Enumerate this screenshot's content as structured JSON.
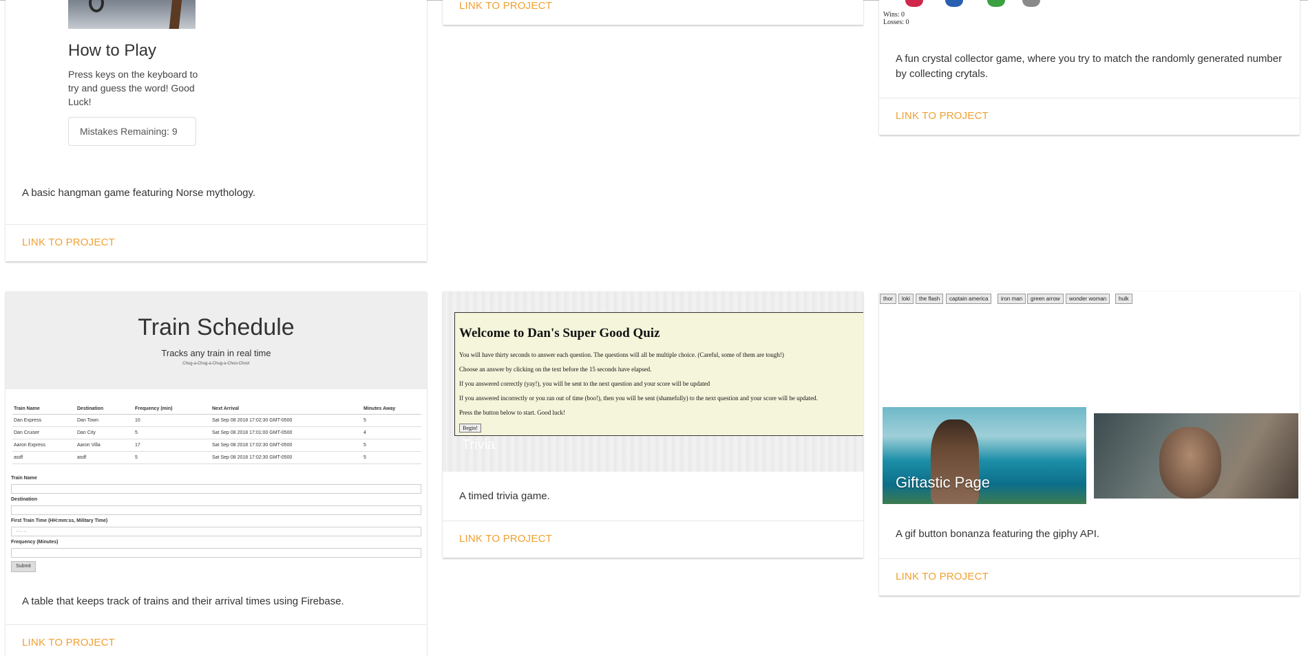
{
  "cards": {
    "hangman": {
      "title": "How to Play",
      "instructions": "Press keys on the keyboard to try and guess the word! Good Luck!",
      "mistakes": "Mistakes Remaining: 9",
      "description": "A basic hangman game featuring Norse mythology.",
      "link": "LINK TO PROJECT"
    },
    "top_middle": {
      "link": "LINK TO PROJECT"
    },
    "crystal": {
      "wins": "Wins: 0",
      "losses": "Losses: 0",
      "description": "A fun crystal collector game, where you try to match the randomly generated number by collecting crytals.",
      "link": "LINK TO PROJECT"
    },
    "train": {
      "title": "Train Schedule",
      "subtitle": "Tracks any train in real time",
      "tiny": "Chug-a-Chug-a-Chug-a-Choo-Choo!",
      "headers": [
        "Train Name",
        "Destination",
        "Frequency (min)",
        "Next Arrival",
        "Minutes Away"
      ],
      "rows": [
        [
          "Dan Express",
          "Dan Town",
          "10",
          "Sat Sep 08 2018 17:02:30 GMT-0500",
          "5"
        ],
        [
          "Dan Cruiser",
          "Dan City",
          "5",
          "Sat Sep 08 2018 17:01:00 GMT-0500",
          "4"
        ],
        [
          "Aaron Express",
          "Aaron Villa",
          "17",
          "Sat Sep 08 2018 17:02:30 GMT-0500",
          "5"
        ],
        [
          "asdf",
          "asdf",
          "5",
          "Sat Sep 08 2018 17:02:30 GMT-0500",
          "5"
        ]
      ],
      "form": {
        "train_name": "Train Name",
        "destination": "Destination",
        "first_time": "First Train Time (HH:mm:ss, Military Time)",
        "first_time_placeholder": "--:-- --",
        "frequency": "Frequency (Minutes)",
        "submit": "Submit"
      },
      "description": "A table that keeps track of trains and their arrival times using Firebase.",
      "link": "LINK TO PROJECT"
    },
    "trivia": {
      "heading": "Welcome to Dan's Super Good Quiz",
      "lines": [
        "You will have thirty seconds to answer each question. The questions will all be multiple choice. (Careful, some of them are tough!)",
        "Choose an answer by clicking on the text before the 15 seconds have elapsed.",
        "If you answered correctly (yay!), you will be sent to the next question and your score will be updated",
        "If you answered incorrectly or you ran out of time (boo!), then you will be sent (shamefully) to the next question and your score will be updated.",
        "Press the button below to start. Good luck!"
      ],
      "begin": "Begin!",
      "overlay_title": "Trivia",
      "description": "A timed trivia game.",
      "link": "LINK TO PROJECT"
    },
    "gif": {
      "buttons": [
        "thor",
        "loki",
        "the flash",
        "captain america",
        "iron man",
        "green arrow",
        "wonder woman",
        "hulk"
      ],
      "overlay_title": "Giftastic Page",
      "description": "A gif button bonanza featuring the giphy API.",
      "link": "LINK TO PROJECT"
    }
  }
}
